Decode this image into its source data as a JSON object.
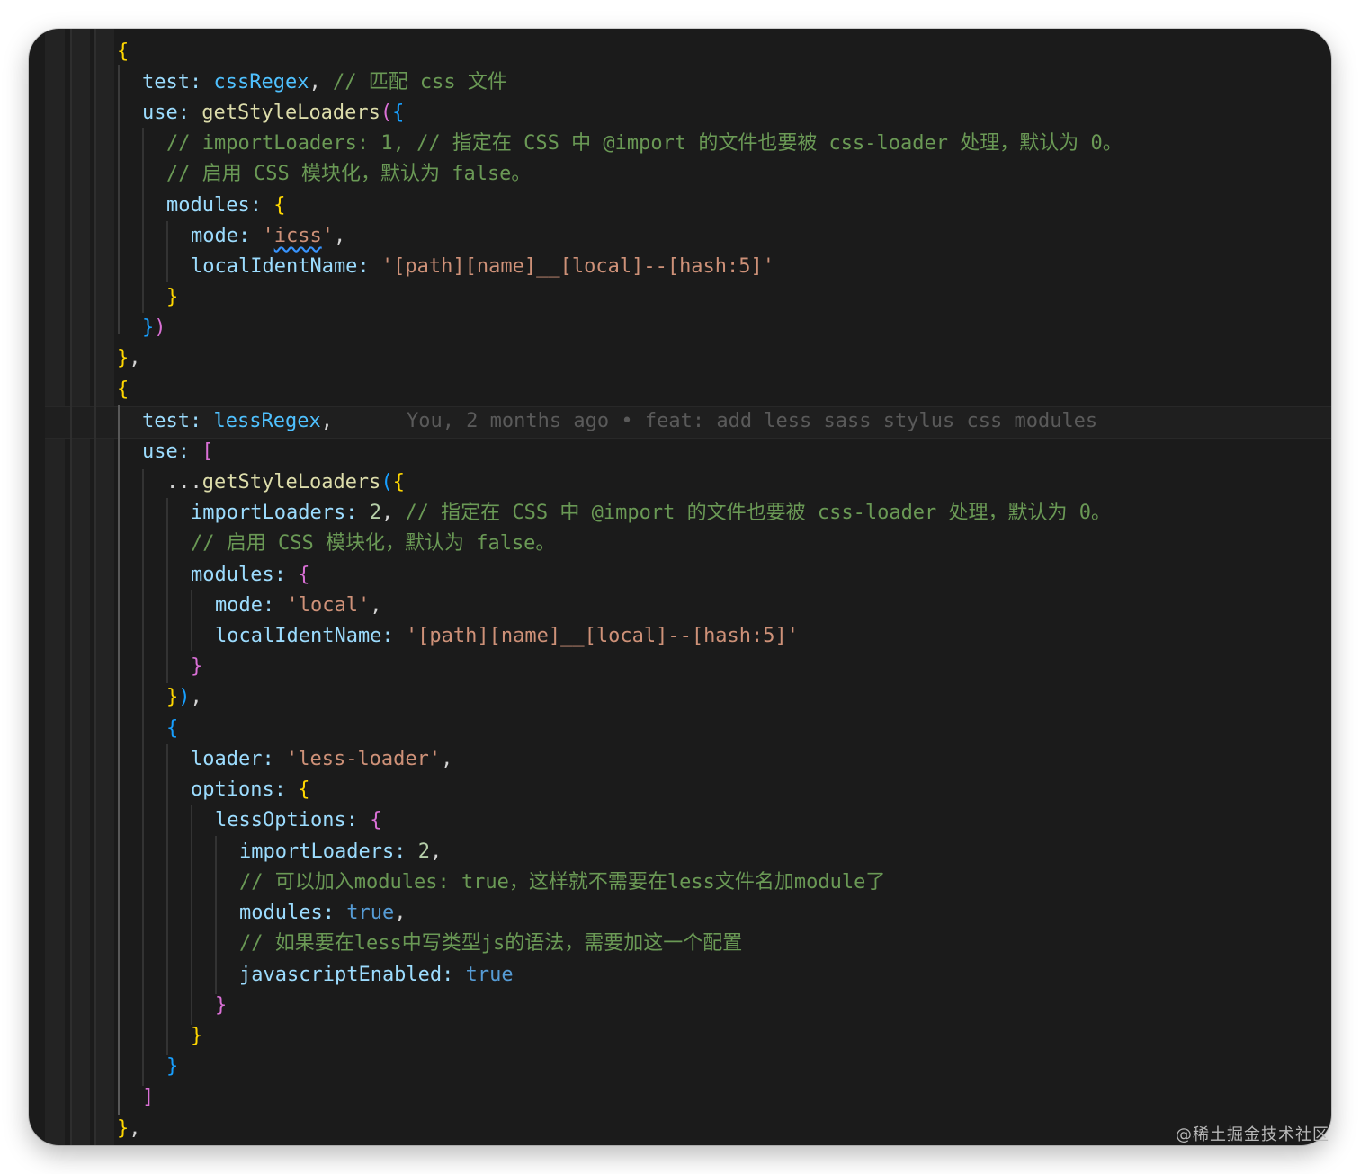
{
  "code": {
    "line1": {
      "brace": "{"
    },
    "line2": {
      "key": "test:",
      "value": "cssRegex",
      "comma": ",",
      "comment": "// 匹配 css 文件"
    },
    "line3": {
      "key": "use:",
      "fn": "getStyleLoaders",
      "paren": "(",
      "brace": "{"
    },
    "line4": {
      "comment": "// importLoaders: 1, // 指定在 CSS 中 @import 的文件也要被 css-loader 处理，默认为 0。"
    },
    "line5": {
      "comment": "// 启用 CSS 模块化，默认为 false。"
    },
    "line6": {
      "key": "modules:",
      "brace": "{"
    },
    "line7": {
      "key": "mode:",
      "q1": "'",
      "value": "icss",
      "q2": "'",
      "comma": ","
    },
    "line8": {
      "key": "localIdentName:",
      "value": "'[path][name]__[local]--[hash:5]'"
    },
    "line9": {
      "brace": "}"
    },
    "line10": {
      "brace": "}",
      "paren": ")"
    },
    "line11": {
      "brace": "}",
      "comma": ","
    },
    "line12": {
      "brace": "{"
    },
    "line13": {
      "key": "test:",
      "value": "lessRegex",
      "comma": ",",
      "blame": "You, 2 months ago • feat: add less sass stylus css modules"
    },
    "line14": {
      "key": "use:",
      "bracket": "["
    },
    "line15": {
      "spread": "...",
      "fn": "getStyleLoaders",
      "paren": "(",
      "brace": "{"
    },
    "line16": {
      "key": "importLoaders:",
      "number": "2",
      "comma": ",",
      "comment": "// 指定在 CSS 中 @import 的文件也要被 css-loader 处理，默认为 0。"
    },
    "line17": {
      "comment": "// 启用 CSS 模块化，默认为 false。"
    },
    "line18": {
      "key": "modules:",
      "brace": "{"
    },
    "line19": {
      "key": "mode:",
      "value": "'local'",
      "comma": ","
    },
    "line20": {
      "key": "localIdentName:",
      "value": "'[path][name]__[local]--[hash:5]'"
    },
    "line21": {
      "brace": "}"
    },
    "line22": {
      "brace": "}",
      "paren": ")",
      "comma": ","
    },
    "line23": {
      "brace": "{"
    },
    "line24": {
      "key": "loader:",
      "value": "'less-loader'",
      "comma": ","
    },
    "line25": {
      "key": "options:",
      "brace": "{"
    },
    "line26": {
      "key": "lessOptions:",
      "brace": "{"
    },
    "line27": {
      "key": "importLoaders:",
      "number": "2",
      "comma": ","
    },
    "line28": {
      "comment": "// 可以加入modules: true，这样就不需要在less文件名加module了"
    },
    "line29": {
      "key": "modules:",
      "value": "true",
      "comma": ","
    },
    "line30": {
      "comment": "// 如果要在less中写类型js的语法，需要加这一个配置"
    },
    "line31": {
      "key": "javascriptEnabled:",
      "value": "true"
    },
    "line32": {
      "brace": "}"
    },
    "line33": {
      "brace": "}"
    },
    "line34": {
      "brace": "}"
    },
    "line35": {
      "bracket": "]"
    },
    "line36": {
      "brace": "}",
      "comma": ","
    }
  },
  "watermark": "@稀土掘金技术社区",
  "colors": {
    "background": "#1b1b1b",
    "property": "#9cdcfe",
    "function": "#dcdcaa",
    "variable": "#4fc1ff",
    "string": "#ce9178",
    "comment": "#6a9955",
    "number": "#b5cea8",
    "keyword": "#569cd6",
    "bracket_gold": "#ffd700",
    "bracket_purple": "#da70d6",
    "bracket_blue": "#179fff"
  }
}
